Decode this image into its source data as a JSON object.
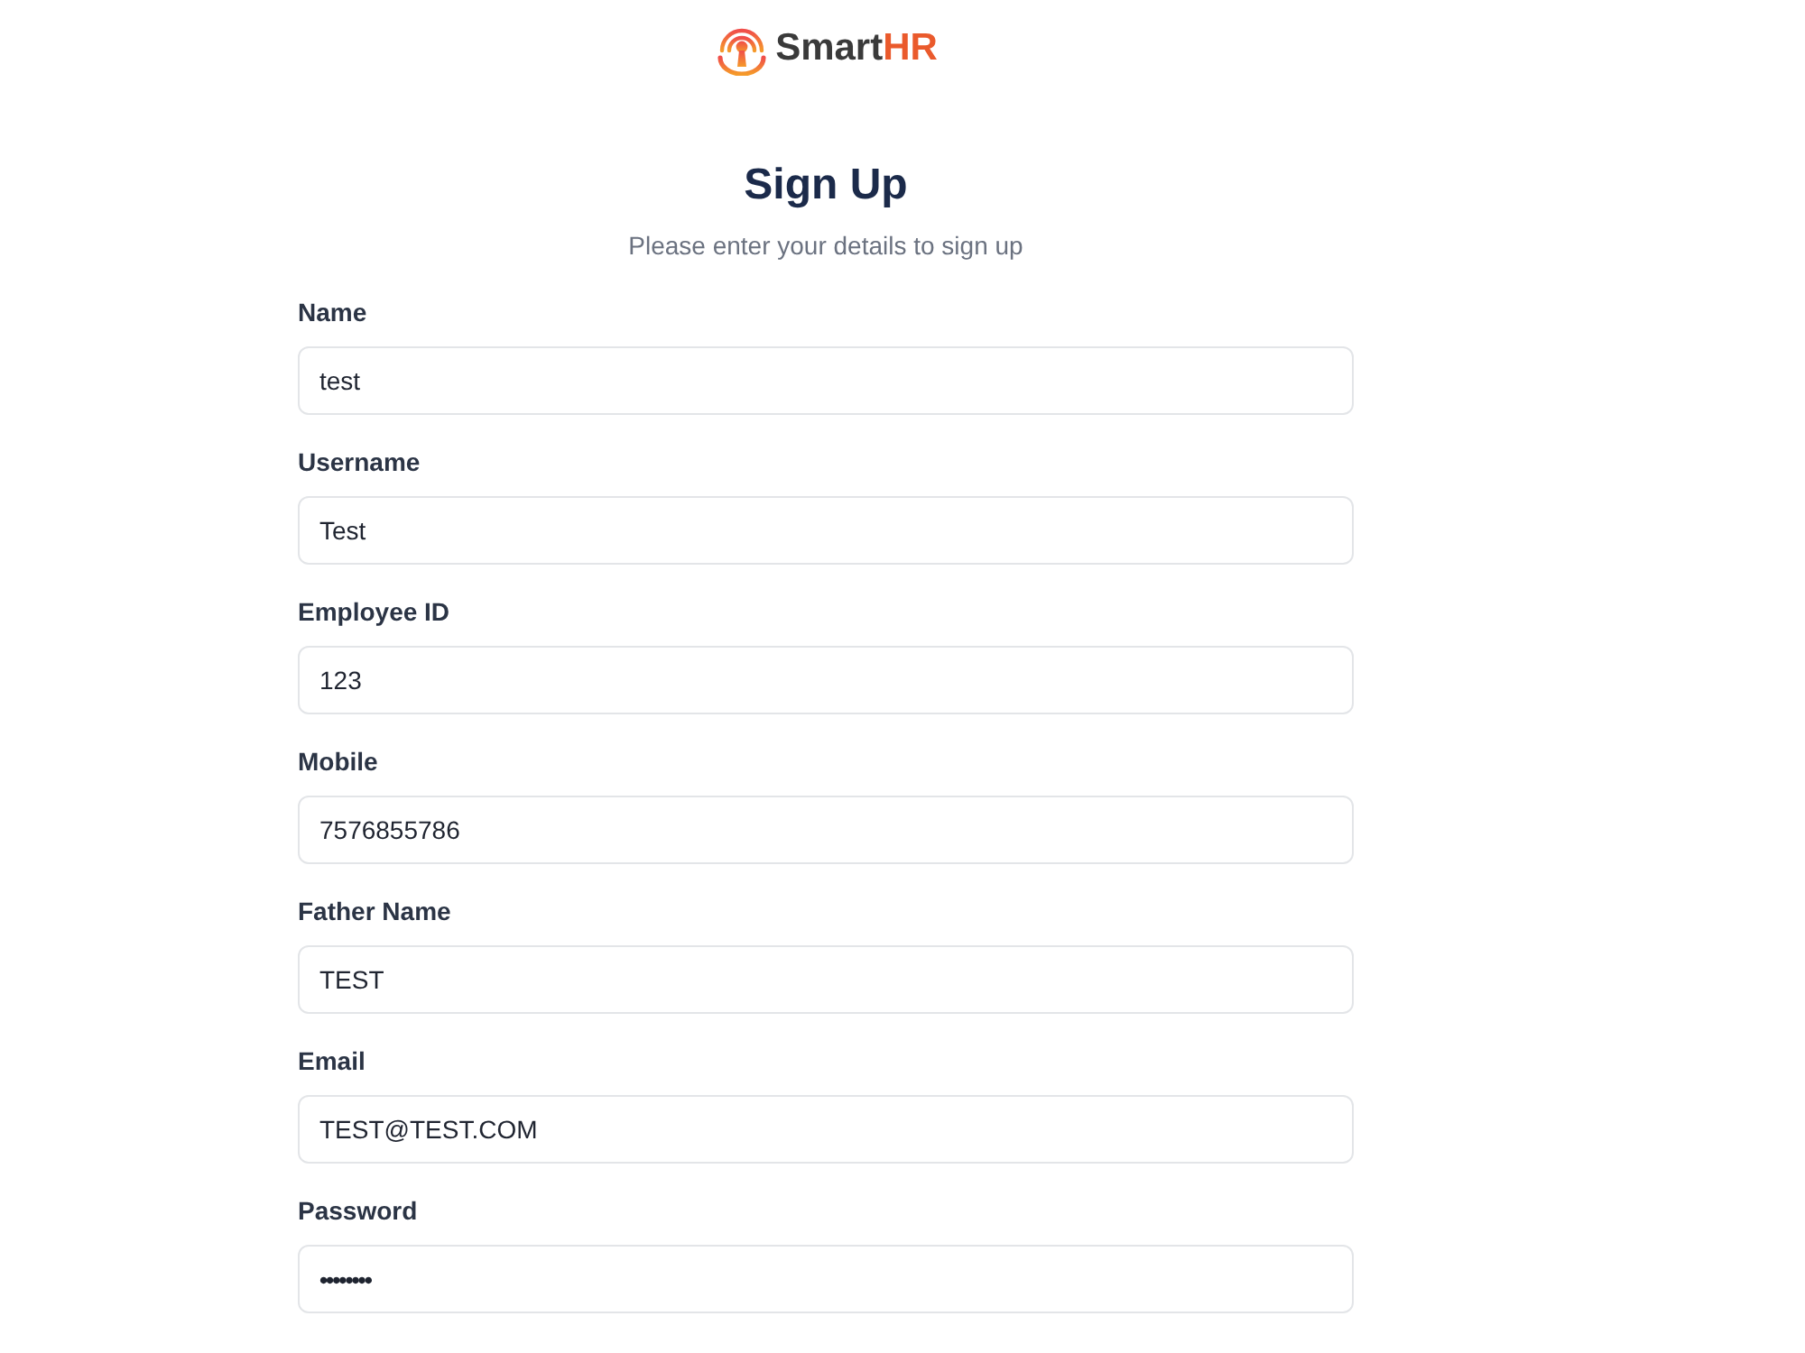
{
  "logo": {
    "text": "Smart",
    "accent": "HR"
  },
  "heading": {
    "title": "Sign Up",
    "subtitle": "Please enter your details to sign up"
  },
  "fields": [
    {
      "label": "Name",
      "kind": "text",
      "value": "test"
    },
    {
      "label": "Username",
      "kind": "text",
      "value": "Test"
    },
    {
      "label": "Employee ID",
      "kind": "text",
      "value": "123"
    },
    {
      "label": "Mobile",
      "kind": "text",
      "value": "7576855786"
    },
    {
      "label": "Father Name",
      "kind": "text",
      "value": "TEST"
    },
    {
      "label": "Email",
      "kind": "text",
      "value": "TEST@TEST.COM"
    },
    {
      "label": "Password",
      "kind": "password",
      "value": "••••••••"
    }
  ]
}
